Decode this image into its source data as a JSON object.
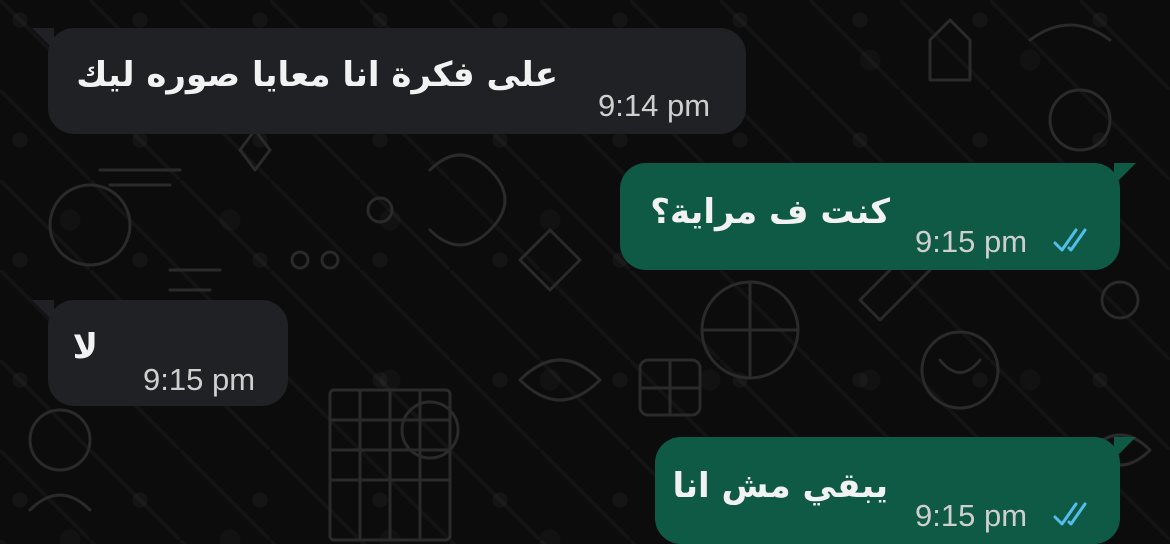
{
  "chat": {
    "messages": [
      {
        "direction": "incoming",
        "text": "على فكرة انا معايا صوره ليك",
        "time": "9:14 pm"
      },
      {
        "direction": "outgoing",
        "text": "كنت ف مراية؟",
        "time": "9:15 pm",
        "status": "read",
        "status_icon": "double-check-icon"
      },
      {
        "direction": "incoming",
        "text": "لا",
        "time": "9:15 pm"
      },
      {
        "direction": "outgoing",
        "text": "يبقي مش انا",
        "time": "9:15 pm",
        "status": "read",
        "status_icon": "double-check-icon"
      }
    ]
  },
  "colors": {
    "background": "#0c0c0c",
    "incoming_bubble": "#202124",
    "outgoing_bubble": "#0e5a45",
    "text": "#f2f2f2",
    "time": "#cfcfcf",
    "read_ticks": "#53bdeb"
  }
}
